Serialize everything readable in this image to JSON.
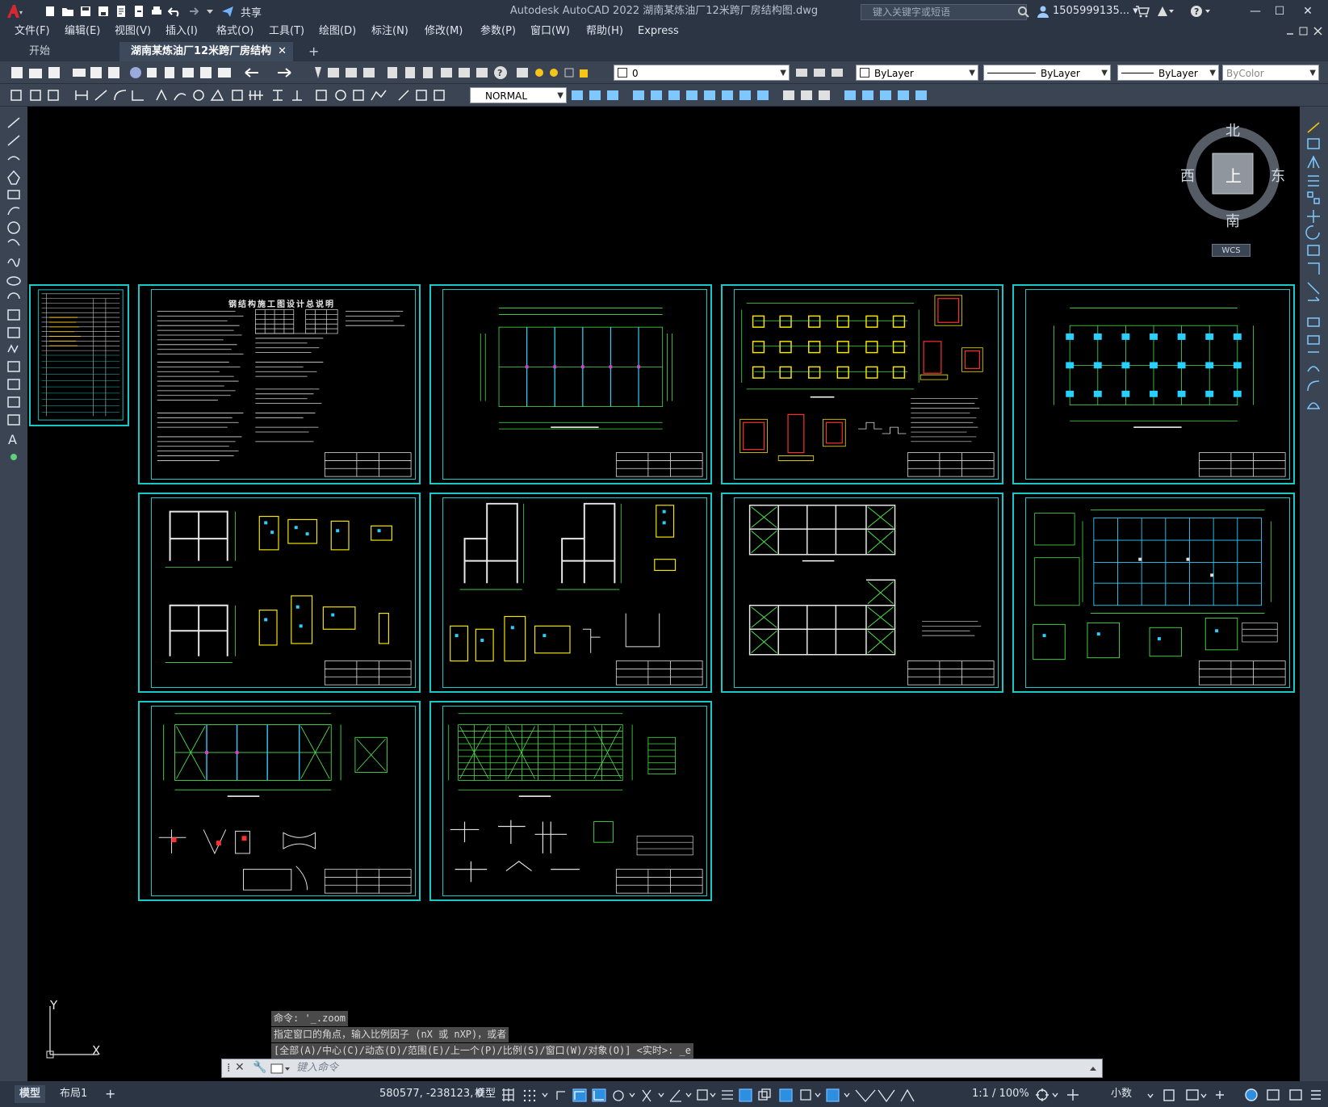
{
  "app": {
    "title": "Autodesk AutoCAD 2022    湖南某炼油厂12米跨厂房结构图.dwg",
    "share_label": "共享",
    "search_placeholder": "键入关键字或短语",
    "user": "1505999135... ▾"
  },
  "menu": [
    "文件(F)",
    "编辑(E)",
    "视图(V)",
    "插入(I)",
    "格式(O)",
    "工具(T)",
    "绘图(D)",
    "标注(N)",
    "修改(M)",
    "参数(P)",
    "窗口(W)",
    "帮助(H)",
    "Express"
  ],
  "tabs": {
    "start": "开始",
    "drawing": "湖南某炼油厂12米跨厂房结构图*"
  },
  "properties": {
    "layer": "0",
    "color": "ByLayer",
    "linetype": "ByLayer",
    "lineweight": "ByLayer",
    "plotstyle": "ByColor",
    "dimstyle": "NORMAL"
  },
  "viewcube": {
    "north": "北",
    "south": "南",
    "east": "东",
    "west": "西",
    "face": "上",
    "wcs": "WCS"
  },
  "ucs": {
    "x": "X",
    "y": "Y"
  },
  "command": {
    "history": [
      "命令: '_.zoom",
      "指定窗口的角点，输入比例因子 (nX 或 nXP)，或者",
      "[全部(A)/中心(C)/动态(D)/范围(E)/上一个(P)/比例(S)/窗口(W)/对象(O)] <实时>: _e"
    ],
    "placeholder": "键入命令"
  },
  "sheets": {
    "notes_title": "钢结构施工图设计总说明"
  },
  "status": {
    "model_tab": "模型",
    "layout_tab": "布局1",
    "coords": "580577, -238123, 0",
    "model_label": "模型",
    "scale": "1:1 / 100%",
    "units": "小数"
  }
}
